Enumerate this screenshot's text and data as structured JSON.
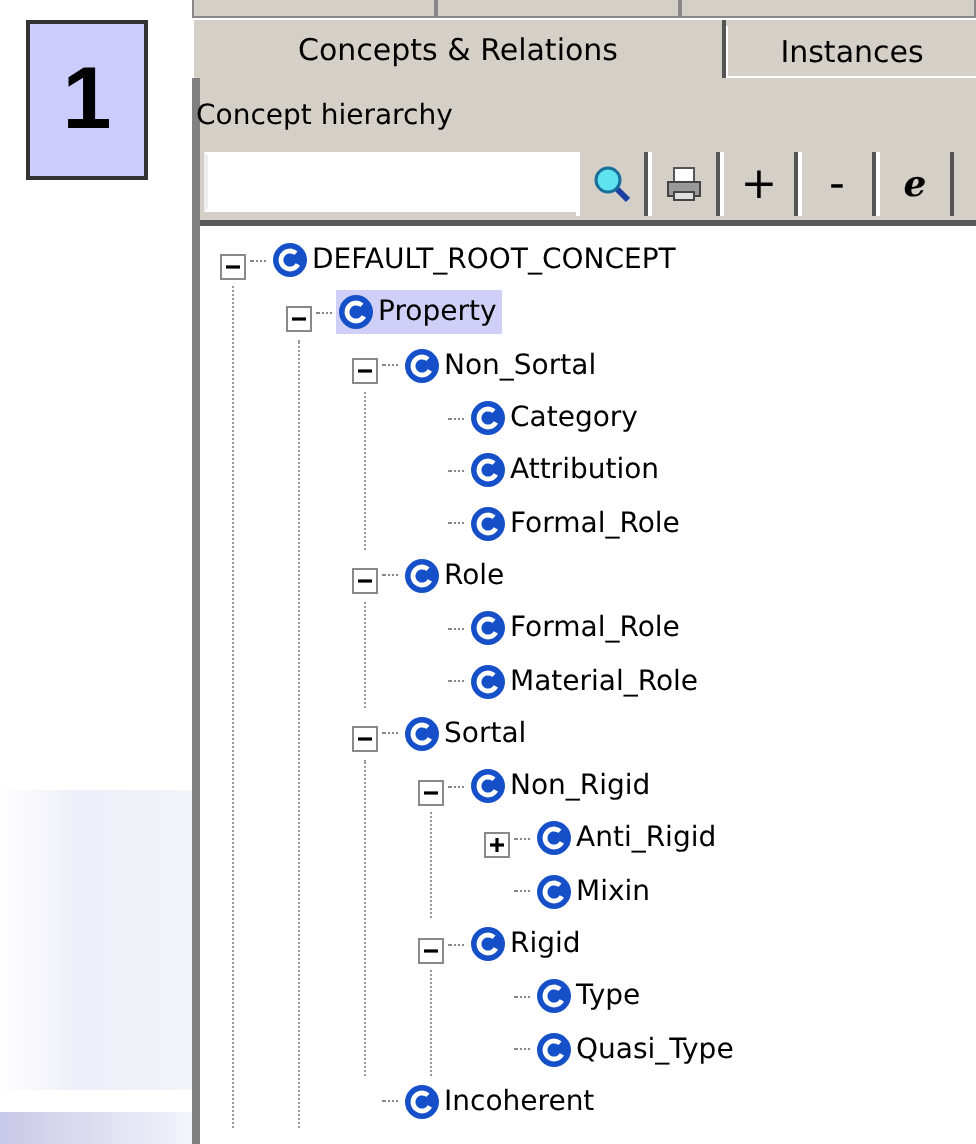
{
  "slide_number": "1",
  "tabs": [
    {
      "label": "Concepts & Relations",
      "selected": true
    },
    {
      "label": "Instances",
      "selected": false
    }
  ],
  "panel": {
    "title": "Concept hierarchy"
  },
  "toolbar": [
    {
      "kind": "search"
    },
    {
      "kind": "print"
    },
    {
      "kind": "text",
      "label": "+"
    },
    {
      "kind": "text",
      "label": "-"
    },
    {
      "kind": "text",
      "label": "e"
    }
  ],
  "tree": [
    {
      "label": "DEFAULT_ROOT_CONCEPT",
      "expanded": true,
      "selected": false,
      "children": [
        {
          "label": "Property",
          "expanded": true,
          "selected": true,
          "children": [
            {
              "label": "Non_Sortal",
              "expanded": true,
              "selected": false,
              "children": [
                {
                  "label": "Category",
                  "selected": false
                },
                {
                  "label": "Attribution",
                  "selected": false
                },
                {
                  "label": "Formal_Role",
                  "selected": false
                }
              ]
            },
            {
              "label": "Role",
              "expanded": true,
              "selected": false,
              "children": [
                {
                  "label": "Formal_Role",
                  "selected": false
                },
                {
                  "label": "Material_Role",
                  "selected": false
                }
              ]
            },
            {
              "label": "Sortal",
              "expanded": true,
              "selected": false,
              "children": [
                {
                  "label": "Non_Rigid",
                  "expanded": true,
                  "selected": false,
                  "children": [
                    {
                      "label": "Anti_Rigid",
                      "expanded": false,
                      "selected": false
                    },
                    {
                      "label": "Mixin",
                      "selected": false
                    }
                  ]
                },
                {
                  "label": "Rigid",
                  "expanded": true,
                  "selected": false,
                  "children": [
                    {
                      "label": "Type",
                      "selected": false
                    },
                    {
                      "label": "Quasi_Type",
                      "selected": false
                    }
                  ]
                }
              ]
            },
            {
              "label": "Incoherent",
              "selected": false
            }
          ]
        }
      ]
    }
  ]
}
